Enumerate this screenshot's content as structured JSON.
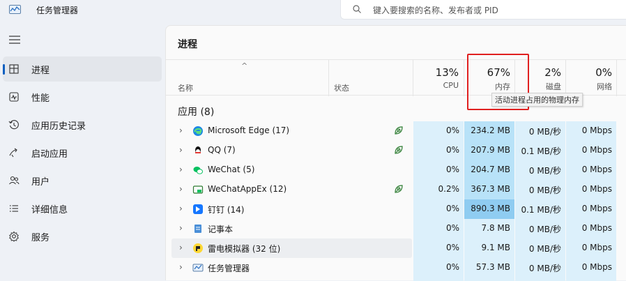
{
  "app": {
    "title": "任务管理器"
  },
  "search": {
    "placeholder": "键入要搜索的名称、发布者或 PID"
  },
  "sidebar": {
    "items": [
      {
        "label": "进程",
        "icon": "processes-icon",
        "active": true
      },
      {
        "label": "性能",
        "icon": "performance-icon",
        "active": false
      },
      {
        "label": "应用历史记录",
        "icon": "history-icon",
        "active": false
      },
      {
        "label": "启动应用",
        "icon": "startup-icon",
        "active": false
      },
      {
        "label": "用户",
        "icon": "users-icon",
        "active": false
      },
      {
        "label": "详细信息",
        "icon": "details-icon",
        "active": false
      },
      {
        "label": "服务",
        "icon": "services-icon",
        "active": false
      }
    ]
  },
  "main": {
    "title": "进程",
    "sort_caret": "^",
    "columns": {
      "name": "名称",
      "status": "状态",
      "cpu": {
        "pct": "13%",
        "label": "CPU"
      },
      "memory": {
        "pct": "67%",
        "label": "内存"
      },
      "disk": {
        "pct": "2%",
        "label": "磁盘"
      },
      "network": {
        "pct": "0%",
        "label": "网络"
      }
    },
    "tooltip": "活动进程占用的物理内存",
    "group_label": "应用 (8)",
    "rows": [
      {
        "name": "Microsoft Edge (17)",
        "icon": "edge-icon",
        "efficiency": true,
        "cpu": "0%",
        "memory": "234.2 MB",
        "disk": "0 MB/秒",
        "network": "0 Mbps"
      },
      {
        "name": "QQ (7)",
        "icon": "qq-icon",
        "efficiency": true,
        "cpu": "0%",
        "memory": "207.9 MB",
        "disk": "0.1 MB/秒",
        "network": "0 Mbps"
      },
      {
        "name": "WeChat (5)",
        "icon": "wechat-icon",
        "efficiency": false,
        "cpu": "0%",
        "memory": "204.7 MB",
        "disk": "0 MB/秒",
        "network": "0 Mbps"
      },
      {
        "name": "WeChatAppEx (12)",
        "icon": "wechatappex-icon",
        "efficiency": true,
        "cpu": "0.2%",
        "memory": "367.3 MB",
        "disk": "0 MB/秒",
        "network": "0 Mbps"
      },
      {
        "name": "钉钉 (14)",
        "icon": "dingtalk-icon",
        "efficiency": false,
        "cpu": "0%",
        "memory": "890.3 MB",
        "disk": "0.1 MB/秒",
        "network": "0 Mbps"
      },
      {
        "name": "记事本",
        "icon": "notepad-icon",
        "efficiency": false,
        "cpu": "0%",
        "memory": "7.8 MB",
        "disk": "0 MB/秒",
        "network": "0 Mbps"
      },
      {
        "name": "雷电模拟器 (32 位)",
        "icon": "ldplayer-icon",
        "efficiency": false,
        "cpu": "0%",
        "memory": "9.1 MB",
        "disk": "0 MB/秒",
        "network": "0 Mbps"
      },
      {
        "name": "任务管理器",
        "icon": "taskmgr-icon",
        "efficiency": false,
        "cpu": "0%",
        "memory": "57.3 MB",
        "disk": "0 MB/秒",
        "network": "0 Mbps"
      }
    ]
  },
  "colors": {
    "heat_light": "#dcf0fb",
    "heat_mid": "#b8e2f8",
    "heat_strong": "#a6d6f4",
    "highlight": "#e02020",
    "accent": "#0b5fc0"
  }
}
